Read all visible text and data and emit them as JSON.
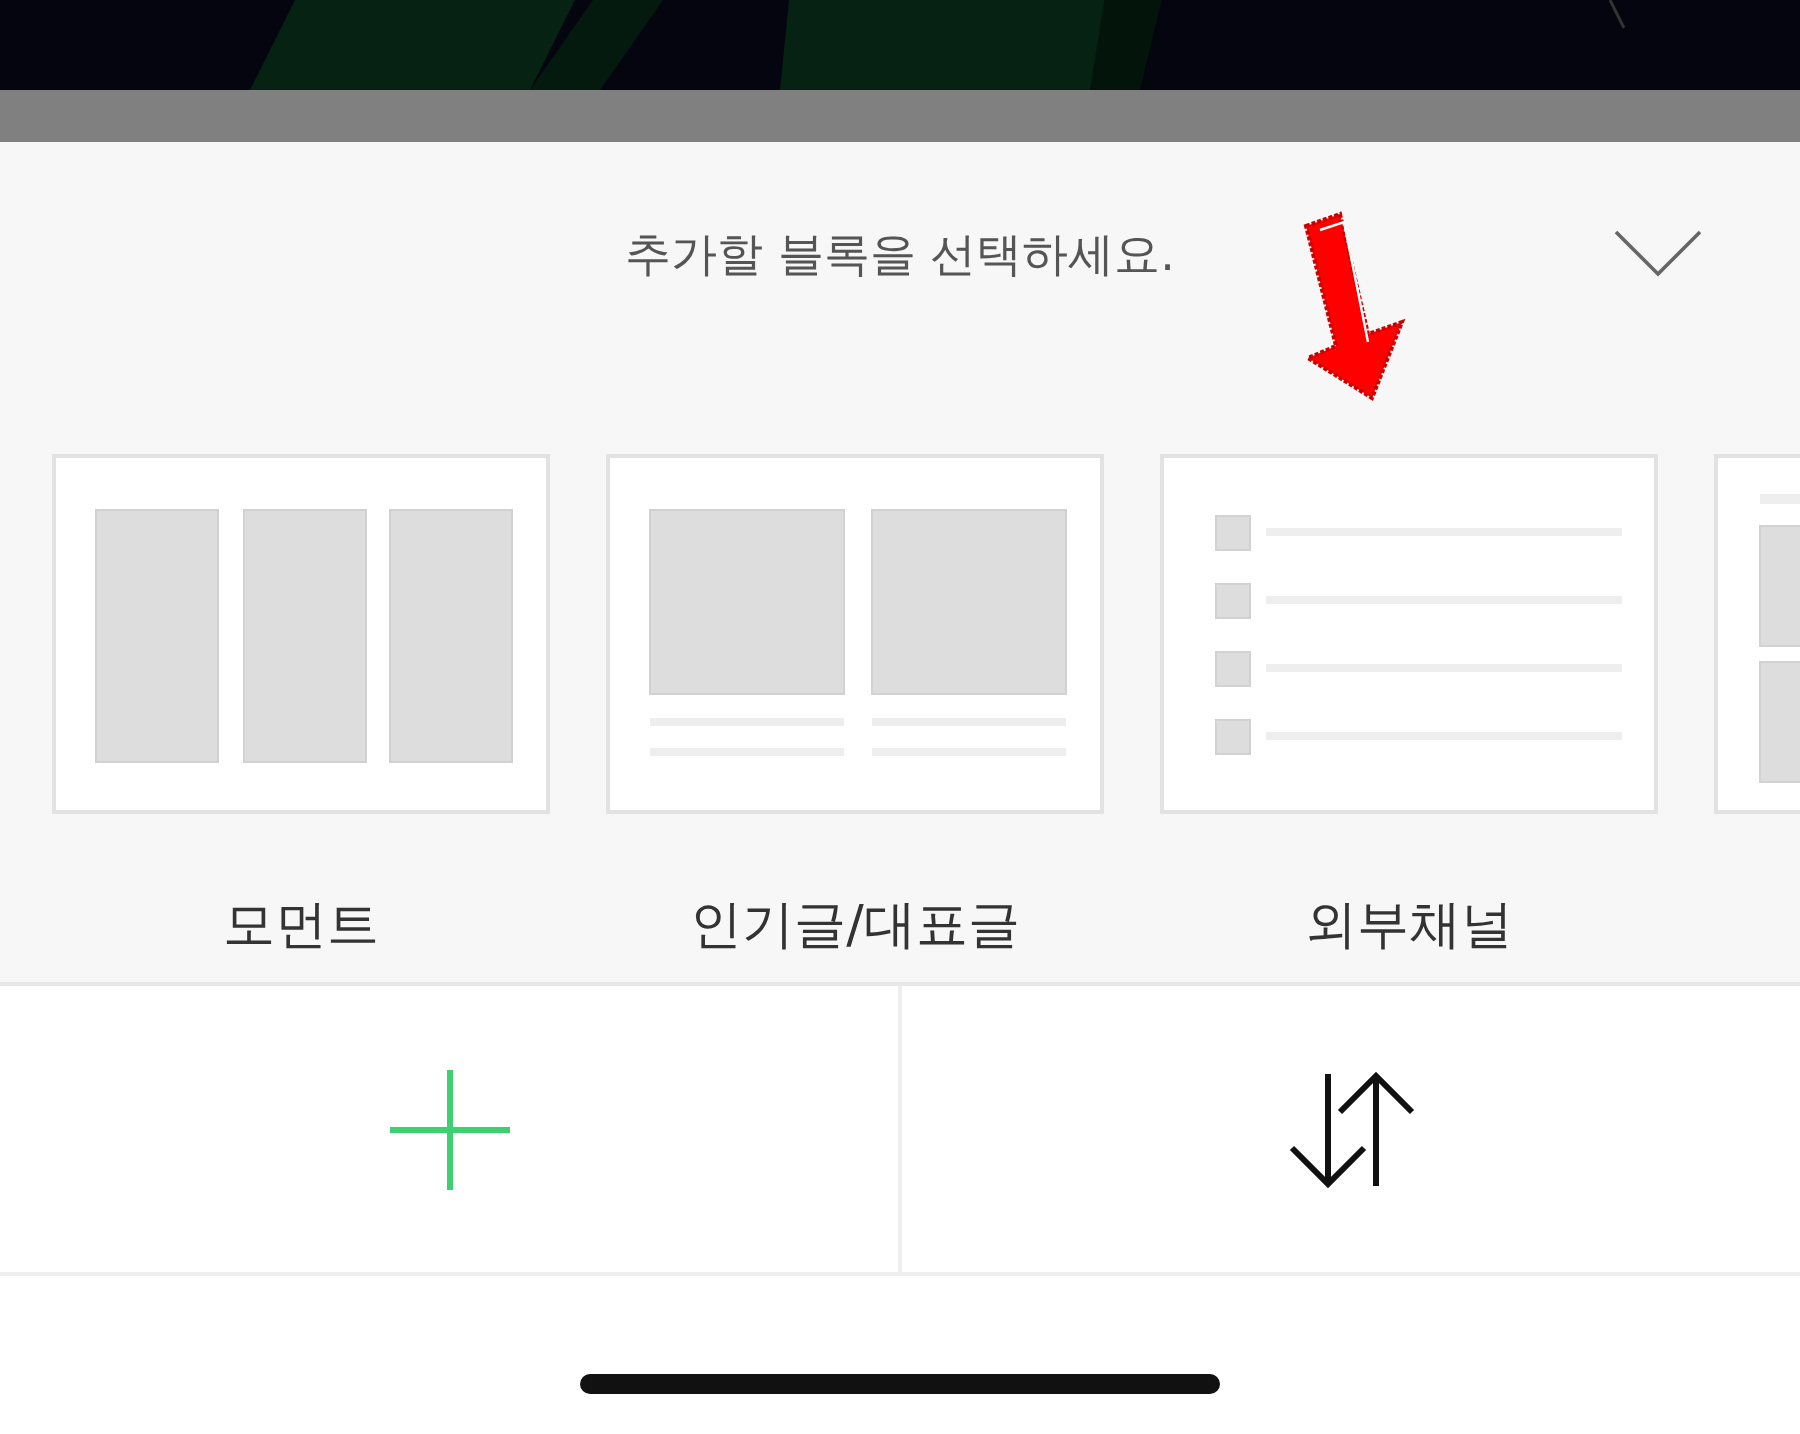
{
  "sheet": {
    "title": "추가할 블록을 선택하세요.",
    "blocks": [
      {
        "kind": "three-columns",
        "label": "모먼트"
      },
      {
        "kind": "two-columns",
        "label": "인기글/대표글"
      },
      {
        "kind": "list",
        "label": "외부채널"
      },
      {
        "kind": "mixed"
      }
    ]
  },
  "actions": [
    {
      "kind": "add"
    },
    {
      "kind": "reorder"
    }
  ]
}
